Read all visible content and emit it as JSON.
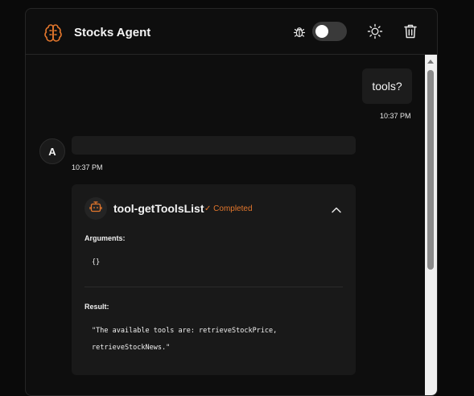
{
  "header": {
    "title": "Stocks Agent",
    "accent_color": "#e2762c",
    "icons": [
      "brain-icon",
      "bug-icon",
      "sun-icon",
      "trash-icon"
    ],
    "debug_toggle": {
      "on": false
    }
  },
  "messages": {
    "user": {
      "text": "tools?",
      "time": "10:37 PM"
    },
    "assistant": {
      "avatar_letter": "A",
      "time": "10:37 PM"
    },
    "tool_call": {
      "name": "tool-getToolsList",
      "status": "✓ Completed",
      "arguments_label": "Arguments:",
      "arguments_value": "{}",
      "result_label": "Result:",
      "result_value": "\"The available tools are: retrieveStockPrice, retrieveStockNews.\""
    }
  }
}
